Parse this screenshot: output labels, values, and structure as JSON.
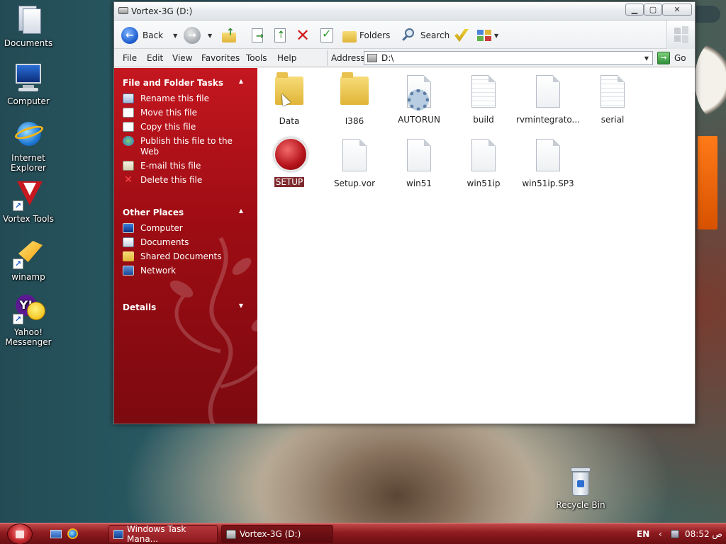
{
  "desktop": {
    "icons": [
      {
        "label": "Documents",
        "icon": "documents-icon"
      },
      {
        "label": "Computer",
        "icon": "computer-icon"
      },
      {
        "label": "Internet Explorer",
        "icon": "internet-explorer-icon"
      },
      {
        "label": "Vortex Tools",
        "icon": "vortex-tools-icon"
      },
      {
        "label": "winamp",
        "icon": "winamp-icon"
      },
      {
        "label": "Yahoo! Messenger",
        "icon": "yahoo-messenger-icon"
      }
    ],
    "recycle_bin": {
      "label": "Recycle Bin",
      "icon": "recycle-bin-icon"
    }
  },
  "window": {
    "title": "Vortex-3G (D:)",
    "toolbar": {
      "back_label": "Back",
      "folders_label": "Folders",
      "search_label": "Search"
    },
    "menu": [
      "File",
      "Edit",
      "View",
      "Favorites",
      "Tools",
      "Help"
    ],
    "address": {
      "label": "Address",
      "value": "D:\\",
      "go_label": "Go"
    },
    "file_tasks": {
      "title": "File and Folder Tasks",
      "items": [
        "Rename this file",
        "Move this file",
        "Copy this file",
        "Publish this file to the Web",
        "E-mail this file",
        "Delete this file"
      ]
    },
    "other_places": {
      "title": "Other Places",
      "items": [
        "Computer",
        "Documents",
        "Shared Documents",
        "Network"
      ]
    },
    "details": {
      "title": "Details"
    },
    "files": [
      {
        "name": "Data",
        "type": "folder"
      },
      {
        "name": "I386",
        "type": "folder"
      },
      {
        "name": "AUTORUN",
        "type": "settings"
      },
      {
        "name": "build",
        "type": "text"
      },
      {
        "name": "rvmintegrato...",
        "type": "blank"
      },
      {
        "name": "serial",
        "type": "text"
      },
      {
        "name": "SETUP",
        "type": "setup",
        "selected": true
      },
      {
        "name": "Setup.vor",
        "type": "blank"
      },
      {
        "name": "win51",
        "type": "blank"
      },
      {
        "name": "win51ip",
        "type": "blank"
      },
      {
        "name": "win51ip.SP3",
        "type": "blank"
      }
    ]
  },
  "taskbar": {
    "tasks": [
      {
        "label": "Windows Task Mana...",
        "active": false
      },
      {
        "label": "Vortex-3G (D:)",
        "active": true
      }
    ],
    "tray": {
      "language": "EN",
      "time": "08:52 ص"
    }
  },
  "colors": {
    "task_pane_red": "#b3121a",
    "taskbar_red": "#8d1a1f",
    "selection": "#7f2b2e"
  }
}
